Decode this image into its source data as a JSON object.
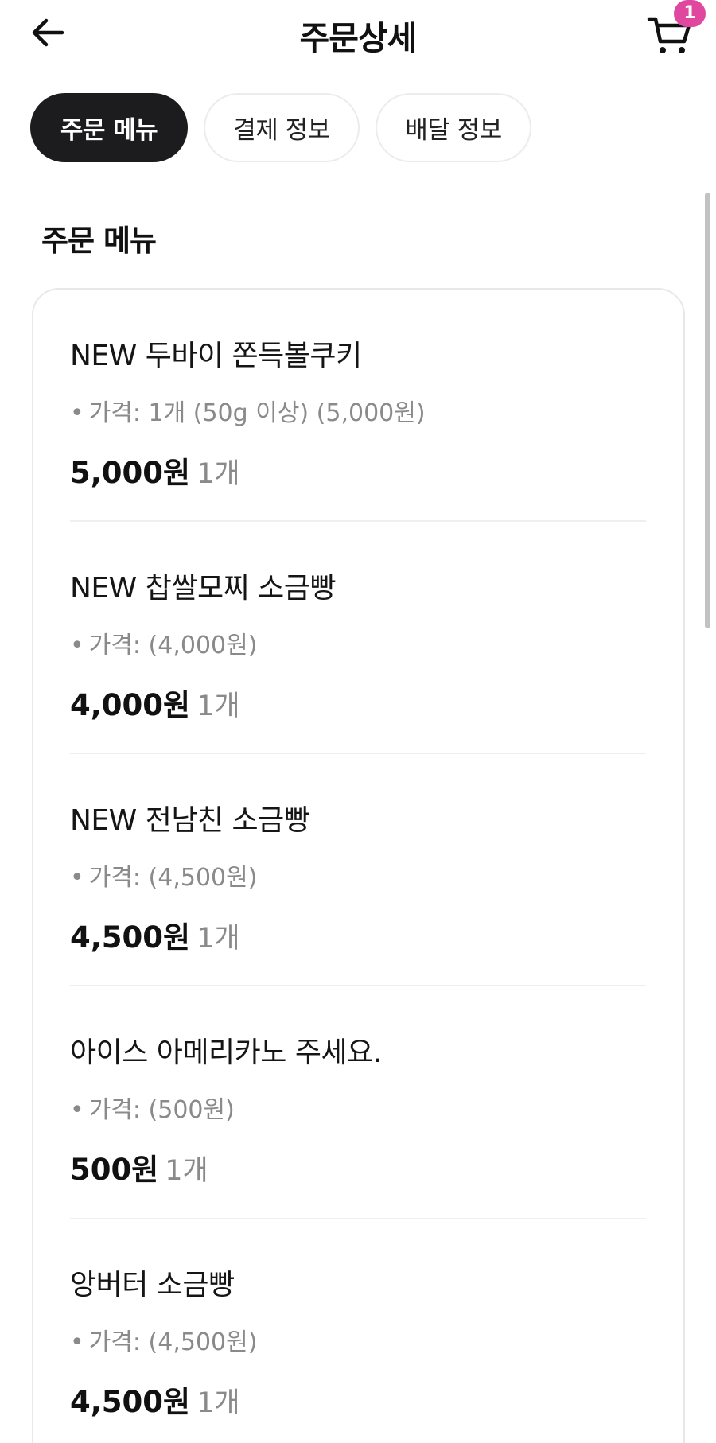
{
  "header": {
    "title": "주문상세",
    "cart_count": "1"
  },
  "tabs": [
    {
      "label": "주문 메뉴",
      "active": true
    },
    {
      "label": "결제 정보",
      "active": false
    },
    {
      "label": "배달 정보",
      "active": false
    }
  ],
  "section_title": "주문 메뉴",
  "items": [
    {
      "name": "NEW 두바이 쫀득볼쿠키",
      "option": "가격: 1개 (50g 이상) (5,000원)",
      "price": "5,000원",
      "qty": "1개"
    },
    {
      "name": "NEW 찹쌀모찌 소금빵",
      "option": "가격: (4,000원)",
      "price": "4,000원",
      "qty": "1개"
    },
    {
      "name": "NEW 전남친 소금빵",
      "option": "가격: (4,500원)",
      "price": "4,500원",
      "qty": "1개"
    },
    {
      "name": "아이스 아메리카노 주세요.",
      "option": "가격: (500원)",
      "price": "500원",
      "qty": "1개"
    },
    {
      "name": "앙버터 소금빵",
      "option": "가격: (4,500원)",
      "price": "4,500원",
      "qty": "1개"
    }
  ],
  "colors": {
    "accent_badge": "#e0479e",
    "active_tab_bg": "#1c1c1e",
    "muted_text": "#8a8a8a"
  },
  "icons": {
    "back": "arrow-left-icon",
    "cart": "cart-icon"
  }
}
